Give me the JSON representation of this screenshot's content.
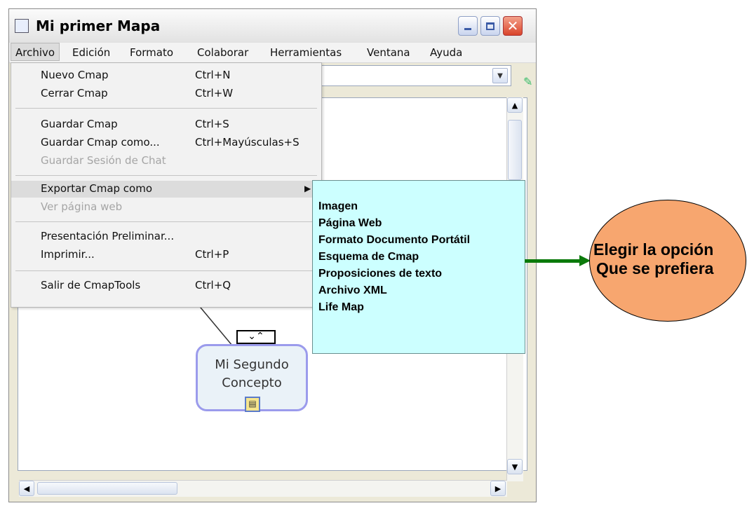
{
  "window": {
    "title": "Mi primer Mapa"
  },
  "menubar": {
    "items": [
      "Archivo",
      "Edición",
      "Formato",
      "Colaborar",
      "Herramientas",
      "Ventana",
      "Ayuda"
    ]
  },
  "archivo_menu": {
    "items": [
      {
        "label": "Nuevo Cmap",
        "shortcut": "Ctrl+N",
        "enabled": true
      },
      {
        "label": "Cerrar Cmap",
        "shortcut": "Ctrl+W",
        "enabled": true
      },
      {
        "label": "Guardar Cmap",
        "shortcut": "Ctrl+S",
        "enabled": true
      },
      {
        "label": "Guardar Cmap como...",
        "shortcut": "Ctrl+Mayúsculas+S",
        "enabled": true
      },
      {
        "label": "Guardar Sesión de Chat",
        "shortcut": "",
        "enabled": false
      },
      {
        "label": "Exportar Cmap como",
        "shortcut": "",
        "enabled": true,
        "highlighted": true,
        "has_submenu": true
      },
      {
        "label": "Ver página web",
        "shortcut": "",
        "enabled": false
      },
      {
        "label": "Presentación Preliminar...",
        "shortcut": "",
        "enabled": true
      },
      {
        "label": "Imprimir...",
        "shortcut": "Ctrl+P",
        "enabled": true
      },
      {
        "label": "Salir de CmapTools",
        "shortcut": "Ctrl+Q",
        "enabled": true
      }
    ]
  },
  "export_submenu": {
    "items": [
      "Imagen",
      "Página Web",
      "Formato Documento Portátil",
      "Esquema de Cmap",
      "Proposiciones de texto",
      "Archivo XML",
      "Life Map"
    ]
  },
  "canvas": {
    "concept_line1": "Mi Segundo",
    "concept_line2": "Concepto"
  },
  "callout": {
    "line1": "Elegir la opción",
    "line2": "Que se prefiera"
  },
  "colors": {
    "submenu_bg": "#ccffff",
    "callout_fill": "#f7a66f",
    "arrow": "#0b7a0b",
    "concept_border": "#9b9bec"
  },
  "icons": [
    "app-icon",
    "minimize-icon",
    "maximize-icon",
    "close-icon",
    "dropdown-icon",
    "edit-tool-icon",
    "submenu-arrow-icon",
    "scroll-up-icon",
    "scroll-down-icon",
    "scroll-left-icon",
    "scroll-right-icon",
    "resource-icon"
  ]
}
